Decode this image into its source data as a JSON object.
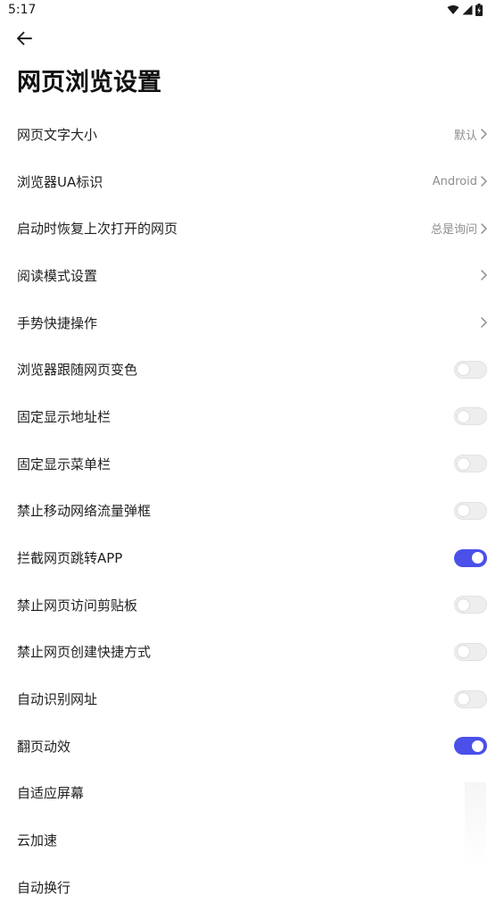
{
  "status_bar": {
    "time": "5:17"
  },
  "header": {
    "back_icon": "arrow-left-icon",
    "title": "网页浏览设置"
  },
  "colors": {
    "accent": "#4a50e8",
    "toggle_off": "#eeeeee",
    "value_text": "#8e8e8e"
  },
  "settings": [
    {
      "label": "网页文字大小",
      "value": "默认",
      "control": "chevron"
    },
    {
      "label": "浏览器UA标识",
      "value": "Android",
      "control": "chevron"
    },
    {
      "label": "启动时恢复上次打开的网页",
      "value": "总是询问",
      "control": "chevron"
    },
    {
      "label": "阅读模式设置",
      "value": "",
      "control": "chevron"
    },
    {
      "label": "手势快捷操作",
      "value": "",
      "control": "chevron"
    },
    {
      "label": "浏览器跟随网页变色",
      "control": "toggle",
      "checked": false
    },
    {
      "label": "固定显示地址栏",
      "control": "toggle",
      "checked": false
    },
    {
      "label": "固定显示菜单栏",
      "control": "toggle",
      "checked": false
    },
    {
      "label": "禁止移动网络流量弹框",
      "control": "toggle",
      "checked": false
    },
    {
      "label": "拦截网页跳转APP",
      "control": "toggle",
      "checked": true
    },
    {
      "label": "禁止网页访问剪贴板",
      "control": "toggle",
      "checked": false
    },
    {
      "label": "禁止网页创建快捷方式",
      "control": "toggle",
      "checked": false
    },
    {
      "label": "自动识别网址",
      "control": "toggle",
      "checked": false
    },
    {
      "label": "翻页动效",
      "control": "toggle",
      "checked": true
    },
    {
      "label": "自适应屏幕",
      "control": "none"
    },
    {
      "label": "云加速",
      "control": "none"
    },
    {
      "label": "自动换行",
      "control": "none"
    }
  ]
}
